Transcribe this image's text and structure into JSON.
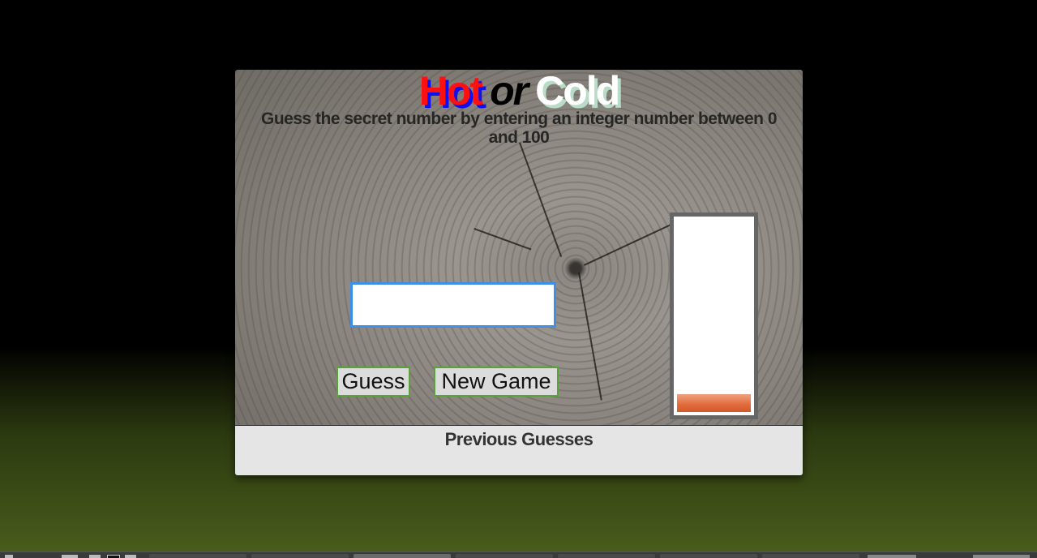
{
  "game": {
    "title": {
      "hot": "Hot",
      "or": "or",
      "cold": "Cold"
    },
    "subtitle": "Guess the secret number by entering an integer number between 0 and 100",
    "input": {
      "value": "",
      "placeholder": ""
    },
    "buttons": {
      "guess": "Guess",
      "new_game": "New Game"
    },
    "thermometer": {
      "level_fraction": 0.09
    },
    "history": {
      "title": "Previous Guesses",
      "items": []
    }
  },
  "colors": {
    "hot": "#ff1010",
    "hot_shadow": "#1010ee",
    "cold": "#ffffff",
    "cold_shadow": "#b8dcc8",
    "input_border": "#3d8fe8",
    "button_border": "#5aa33a",
    "thermo_fill": "#e06a3a"
  }
}
